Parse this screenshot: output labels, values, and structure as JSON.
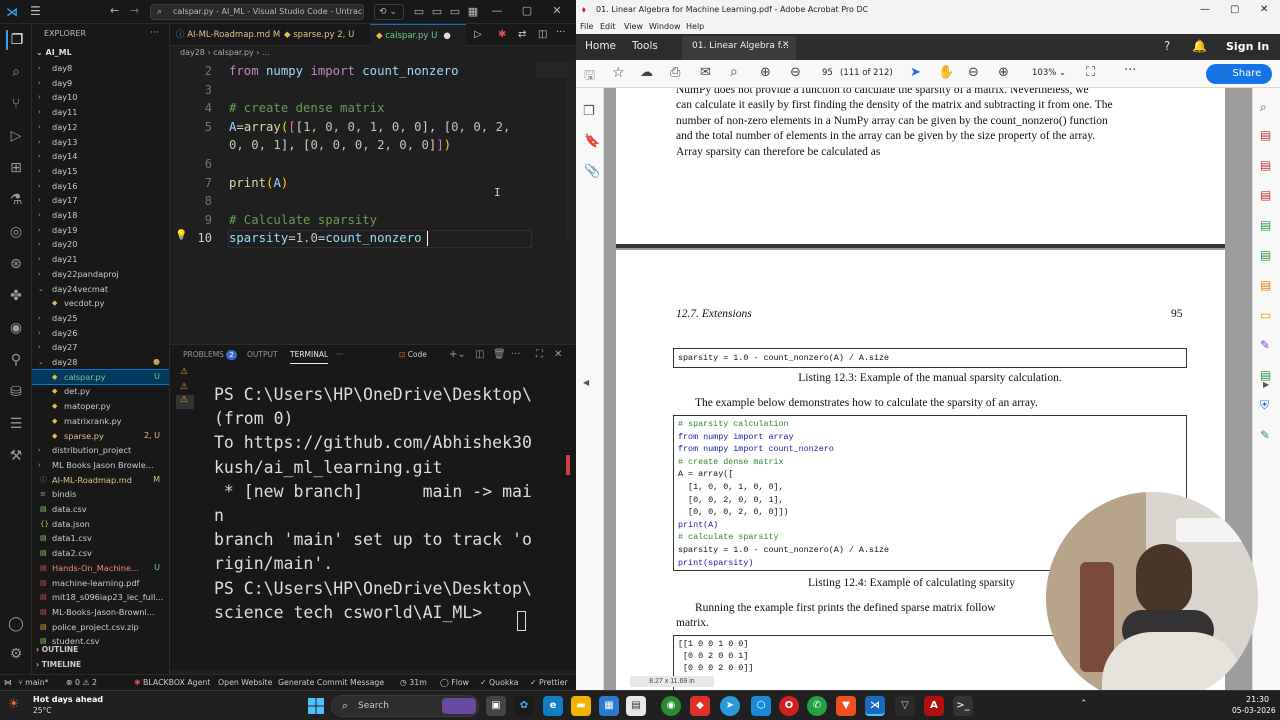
{
  "vscode": {
    "search_text": "calspar.py - AI_ML - Visual Studio Code - Untracked",
    "explorer_title": "EXPLORER",
    "root_folder": "AI_ML",
    "tree": [
      {
        "label": "day8",
        "chev": "›",
        "indent": 1,
        "color": "#ccc"
      },
      {
        "label": "day9",
        "chev": "›",
        "indent": 1,
        "color": "#ccc"
      },
      {
        "label": "day10",
        "chev": "›",
        "indent": 1,
        "color": "#ccc"
      },
      {
        "label": "day11",
        "chev": "›",
        "indent": 1,
        "color": "#ccc"
      },
      {
        "label": "day12",
        "chev": "›",
        "indent": 1,
        "color": "#ccc"
      },
      {
        "label": "day13",
        "chev": "›",
        "indent": 1,
        "color": "#ccc"
      },
      {
        "label": "day14",
        "chev": "›",
        "indent": 1,
        "color": "#ccc"
      },
      {
        "label": "day15",
        "chev": "›",
        "indent": 1,
        "color": "#ccc"
      },
      {
        "label": "day16",
        "chev": "›",
        "indent": 1,
        "color": "#ccc"
      },
      {
        "label": "day17",
        "chev": "›",
        "indent": 1,
        "color": "#ccc"
      },
      {
        "label": "day18",
        "chev": "›",
        "indent": 1,
        "color": "#ccc"
      },
      {
        "label": "day19",
        "chev": "›",
        "indent": 1,
        "color": "#ccc"
      },
      {
        "label": "day20",
        "chev": "›",
        "indent": 1,
        "color": "#ccc"
      },
      {
        "label": "day21",
        "chev": "›",
        "indent": 1,
        "color": "#ccc"
      },
      {
        "label": "day22pandaproj",
        "chev": "›",
        "indent": 1,
        "color": "#ccc"
      },
      {
        "label": "day24vecmat",
        "chev": "⌄",
        "indent": 1,
        "color": "#ccc"
      },
      {
        "label": "vecdot.py",
        "chev": "",
        "indent": 2,
        "color": "#ccc",
        "icon": "py"
      },
      {
        "label": "day25",
        "chev": "›",
        "indent": 1,
        "color": "#ccc"
      },
      {
        "label": "day26",
        "chev": "›",
        "indent": 1,
        "color": "#ccc"
      },
      {
        "label": "day27",
        "chev": "›",
        "indent": 1,
        "color": "#ccc"
      },
      {
        "label": "day28",
        "chev": "⌄",
        "indent": 1,
        "color": "#ccc",
        "status": "●",
        "stcolor": "#c0a060"
      },
      {
        "label": "calspar.py",
        "chev": "",
        "indent": 2,
        "color": "#73c991",
        "icon": "py",
        "status": "U",
        "stcolor": "#73c991",
        "selected": true
      },
      {
        "label": "det.py",
        "chev": "",
        "indent": 2,
        "color": "#ccc",
        "icon": "py"
      },
      {
        "label": "matoper.py",
        "chev": "",
        "indent": 2,
        "color": "#ccc",
        "icon": "py"
      },
      {
        "label": "matrixrank.py",
        "chev": "",
        "indent": 2,
        "color": "#ccc",
        "icon": "py"
      },
      {
        "label": "sparse.py",
        "chev": "",
        "indent": 2,
        "color": "#e2c08d",
        "icon": "py",
        "status": "2, U",
        "stcolor": "#e2c08d"
      },
      {
        "label": "distribution_project",
        "chev": "›",
        "indent": 1,
        "color": "#ccc"
      },
      {
        "label": "ML Books Jason Browle...",
        "chev": "›",
        "indent": 1,
        "color": "#ccc"
      },
      {
        "label": "AI-ML-Roadmap.md",
        "chev": "",
        "indent": 1,
        "color": "#e2c08d",
        "icon": "md",
        "status": "M",
        "stcolor": "#e2c08d"
      },
      {
        "label": "bindis",
        "chev": "",
        "indent": 1,
        "color": "#ccc",
        "icon": "file"
      },
      {
        "label": "data.csv",
        "chev": "",
        "indent": 1,
        "color": "#ccc",
        "icon": "csv"
      },
      {
        "label": "data.json",
        "chev": "",
        "indent": 1,
        "color": "#ccc",
        "icon": "json"
      },
      {
        "label": "data1.csv",
        "chev": "",
        "indent": 1,
        "color": "#ccc",
        "icon": "csv"
      },
      {
        "label": "data2.csv",
        "chev": "",
        "indent": 1,
        "color": "#ccc",
        "icon": "csv"
      },
      {
        "label": "Hands-On_Machine...",
        "chev": "",
        "indent": 1,
        "color": "#f48771",
        "icon": "pdf",
        "status": "U",
        "stcolor": "#73c991"
      },
      {
        "label": "machine-learning.pdf",
        "chev": "",
        "indent": 1,
        "color": "#ccc",
        "icon": "pdf"
      },
      {
        "label": "mit18_s096iap23_lec_full...",
        "chev": "",
        "indent": 1,
        "color": "#ccc",
        "icon": "pdf"
      },
      {
        "label": "ML-Books-Jason-Brownl...",
        "chev": "",
        "indent": 1,
        "color": "#ccc",
        "icon": "pdf"
      },
      {
        "label": "police_project.csv.zip",
        "chev": "",
        "indent": 1,
        "color": "#ccc",
        "icon": "zip"
      },
      {
        "label": "student.csv",
        "chev": "",
        "indent": 1,
        "color": "#ccc",
        "icon": "csv"
      }
    ],
    "outline_label": "OUTLINE",
    "timeline_label": "TIMELINE",
    "tabs": [
      {
        "label": "AI-ML-Roadmap.md",
        "status": "M",
        "color": "#e2c08d"
      },
      {
        "label": "sparse.py",
        "status": "2, U",
        "color": "#e2c08d"
      },
      {
        "label": "calspar.py",
        "status": "U",
        "color": "#73c991",
        "active": true
      }
    ],
    "breadcrumb": "day28 › calspar.py › ...",
    "code_lines": [
      {
        "n": "2",
        "parts": [
          [
            "from ",
            "kw"
          ],
          [
            "numpy ",
            "vr"
          ],
          [
            "import ",
            "kw"
          ],
          [
            "count_nonzero",
            "vr"
          ]
        ]
      },
      {
        "n": "3",
        "parts": []
      },
      {
        "n": "4",
        "parts": [
          [
            "# create dense matrix",
            "cm"
          ]
        ]
      },
      {
        "n": "5",
        "parts": [
          [
            "A",
            "vr"
          ],
          [
            "=",
            "pl"
          ],
          [
            "array",
            "fn"
          ],
          [
            "(",
            "pu"
          ],
          [
            "[",
            "pr"
          ],
          [
            "[",
            "pl"
          ],
          [
            "1, 0, 0, 1, 0, 0",
            "nm"
          ],
          [
            "], [",
            "pl"
          ],
          [
            "0, 0, 2,",
            "nm"
          ]
        ]
      },
      {
        "n": "",
        "parts": [
          [
            "0, 0, 1",
            "nm"
          ],
          [
            "], [",
            "pl"
          ],
          [
            "0, 0, 0, 2, 0, 0",
            "nm"
          ],
          [
            "]",
            "pl"
          ],
          [
            "]",
            "pr"
          ],
          [
            ")",
            "pu"
          ]
        ]
      },
      {
        "n": "6",
        "parts": []
      },
      {
        "n": "7",
        "parts": [
          [
            "print",
            "fn"
          ],
          [
            "(",
            "pu"
          ],
          [
            "A",
            "vr"
          ],
          [
            ")",
            "pu"
          ]
        ]
      },
      {
        "n": "8",
        "parts": []
      },
      {
        "n": "9",
        "parts": [
          [
            "# Calculate sparsity",
            "cm"
          ]
        ]
      },
      {
        "n": "10",
        "parts": [
          [
            "sparsity",
            "vr"
          ],
          [
            "=",
            "pl"
          ],
          [
            "1.0",
            "nm"
          ],
          [
            "=",
            "pl"
          ],
          [
            "count_nonzero",
            "vr"
          ]
        ]
      }
    ],
    "panel_tabs": {
      "problems": "PROBLEMS",
      "problems_count": "2",
      "output": "OUTPUT",
      "terminal": "TERMINAL",
      "more": "···",
      "shell": "Code"
    },
    "terminal_lines": [
      "PS C:\\Users\\HP\\OneDrive\\Desktop\\",
      "(from 0)",
      "To https://github.com/Abhishek30",
      "kush/ai_ml_learning.git",
      " * [new branch]      main -> mai",
      "n",
      "branch 'main' set up to track 'o",
      "rigin/main'.",
      "PS C:\\Users\\HP\\OneDrive\\Desktop\\",
      "science tech csworld\\AI_ML> "
    ],
    "status": {
      "branch": "main*",
      "errors": "0",
      "warnings": "2",
      "blackbox": "BLACKBOX Agent",
      "open_website": "Open Website",
      "commit": "Generate Commit Message",
      "time": "31m",
      "flow": "Flow",
      "quokka": "Quokka",
      "prettier": "Prettier"
    }
  },
  "acrobat": {
    "title": "01. Linear Algebra for Machine Learning.pdf - Adobe Acrobat Pro DC",
    "menu": [
      "File",
      "Edit",
      "View",
      "Window",
      "Help"
    ],
    "home_tab": "Home",
    "tools_tab": "Tools",
    "doc_tab": "01. Linear Algebra f...",
    "sign_in": "Sign In",
    "share": "Share",
    "page_num": "95",
    "page_of": "(111 of 212)",
    "zoom": "103%",
    "page_size": "8.27 x 11.69 in",
    "prev_page_lines": [
      "NumPy does not provide a function to calculate the sparsity of a matrix. Nevertheless, we",
      "can calculate it easily by first finding the density of the matrix and subtracting it from one. The",
      "number of non-zero elements in a NumPy array can be given by the count_nonzero() function",
      "and the total number of elements in the array can be given by the size property of the array.",
      "Array sparsity can therefore be calculated as"
    ],
    "section_header": "12.7. Extensions",
    "page_number_label": "95",
    "listing1_code": "sparsity = 1.0 - count_nonzero(A) / A.size",
    "listing1_caption": "Listing 12.3: Example of the manual sparsity calculation.",
    "para1": "The example below demonstrates how to calculate the sparsity of an array.",
    "listing2_lines": [
      [
        "# sparsity calculation",
        "cm2"
      ],
      [
        "from numpy import array",
        "kw2"
      ],
      [
        "from numpy import count_nonzero",
        "kw2"
      ],
      [
        "# create dense matrix",
        "cm2"
      ],
      [
        "A = array([",
        ""
      ],
      [
        "  [1, 0, 0, 1, 0, 0],",
        ""
      ],
      [
        "  [0, 0, 2, 0, 0, 1],",
        ""
      ],
      [
        "  [0, 0, 0, 2, 0, 0]])",
        ""
      ],
      [
        "print(A)",
        "kw2"
      ],
      [
        "# calculate sparsity",
        "cm2"
      ],
      [
        "sparsity = 1.0 - count_nonzero(A) / A.size",
        ""
      ],
      [
        "print(sparsity)",
        "kw2"
      ]
    ],
    "listing2_caption": "Listing 12.4: Example of calculating sparsity",
    "para2_line1": "Running the example first prints the defined sparse matrix follow",
    "para2_line2": "matrix.",
    "output_lines": [
      "[[1 0 0 1 0 0]",
      " [0 0 2 0 0 1]",
      " [0 0 0 2 0 0]]"
    ]
  },
  "taskbar": {
    "weather_title": "Hot days ahead",
    "weather_temp": "25°C",
    "search": "Search",
    "time": "21:30",
    "date": "05-03-2026"
  }
}
